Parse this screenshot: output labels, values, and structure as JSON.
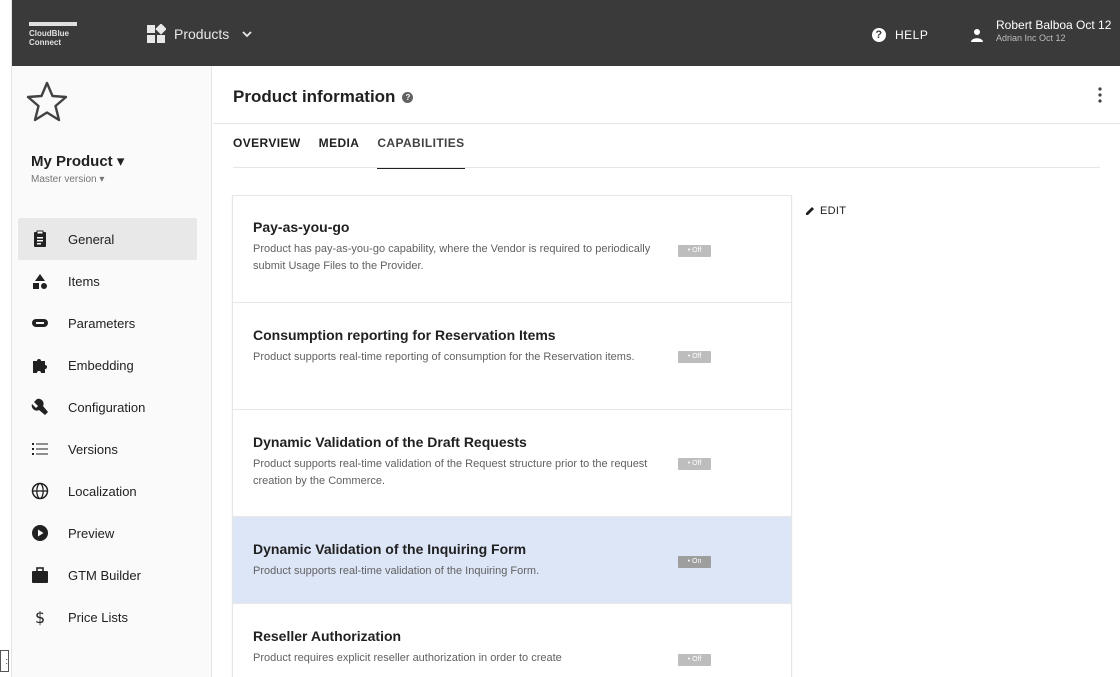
{
  "topbar": {
    "logo_line1": "CloudBlue",
    "logo_line2": "Connect",
    "products_label": "Products",
    "help_label": "HELP",
    "user_name": "Robert Balboa Oct 12",
    "user_account": "Adrian Inc Oct 12"
  },
  "sidebar": {
    "product_name": "My Product ▾",
    "version": "Master version ▾",
    "items": [
      {
        "label": "General",
        "icon": "clipboard-icon"
      },
      {
        "label": "Items",
        "icon": "shapes-icon"
      },
      {
        "label": "Parameters",
        "icon": "toggle-icon"
      },
      {
        "label": "Embedding",
        "icon": "puzzle-icon"
      },
      {
        "label": "Configuration",
        "icon": "wrench-icon"
      },
      {
        "label": "Versions",
        "icon": "list-icon"
      },
      {
        "label": "Localization",
        "icon": "globe-icon"
      },
      {
        "label": "Preview",
        "icon": "play-icon"
      },
      {
        "label": "GTM Builder",
        "icon": "briefcase-icon"
      },
      {
        "label": "Price Lists",
        "icon": "dollar-icon"
      }
    ],
    "active_item": "General"
  },
  "main": {
    "title": "Product information",
    "tabs": [
      {
        "label": "OVERVIEW"
      },
      {
        "label": "MEDIA"
      },
      {
        "label": "CAPABILITIES"
      }
    ],
    "active_tab": "CAPABILITIES",
    "edit_label": "EDIT",
    "capabilities": [
      {
        "title": "Pay-as-you-go",
        "description": "Product has pay-as-you-go capability, where the Vendor is required to periodically submit Usage Files to the Provider.",
        "toggle": "Off"
      },
      {
        "title": "Consumption reporting for Reservation Items",
        "description": "Product supports real-time reporting of consumption for the Reservation items.",
        "toggle": "Off"
      },
      {
        "title": "Dynamic Validation of the Draft Requests",
        "description": "Product supports real-time validation of the Request structure prior to the request creation by the Commerce.",
        "toggle": "Off"
      },
      {
        "title": "Dynamic Validation of the Inquiring Form",
        "description": "Product supports real-time validation of the Inquiring Form.",
        "toggle": "On"
      },
      {
        "title": "Reseller Authorization",
        "description": "Product requires explicit reseller authorization in order to create",
        "toggle": "Off"
      }
    ]
  },
  "colors": {
    "topbar_bg": "#3a3a3a",
    "highlight_bg": "#dde6f7",
    "active_nav_bg": "#e8e8e8"
  }
}
